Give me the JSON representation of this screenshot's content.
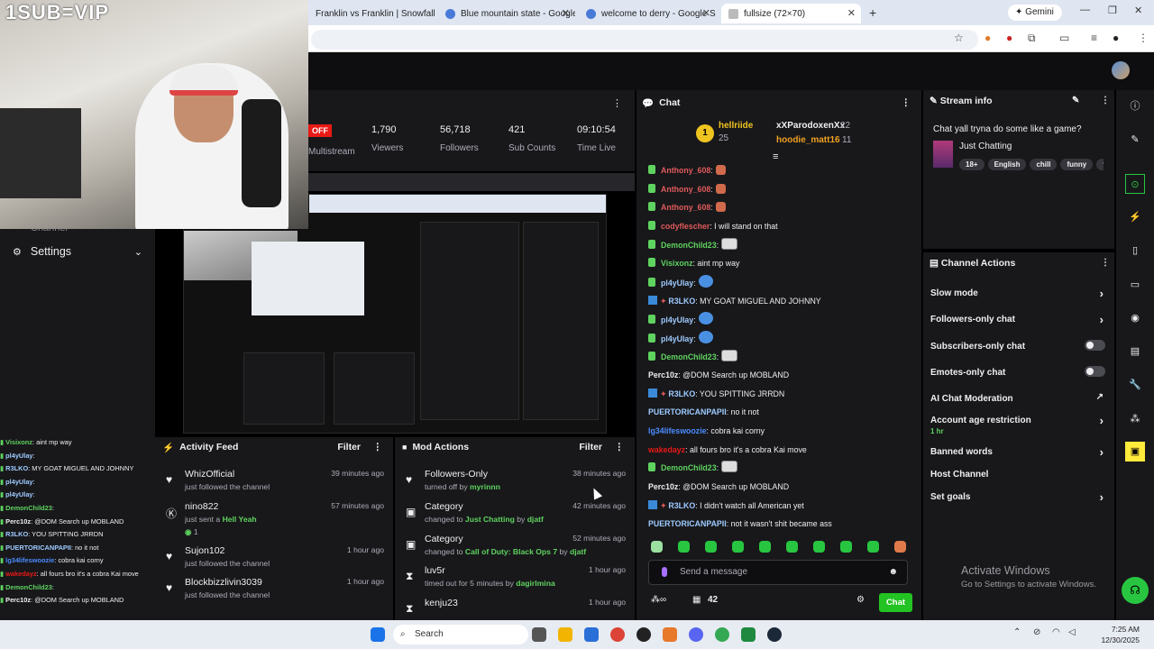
{
  "browser": {
    "tabs": [
      {
        "title": "Franklin vs Franklin | Snowfall |"
      },
      {
        "title": "Blue mountain state - Google S"
      },
      {
        "title": "welcome to derry - Google Sea"
      },
      {
        "title": "fullsize (72×70)"
      }
    ],
    "gemini_label": "Gemini"
  },
  "overlay": {
    "vip_text": "1SUB=VIP"
  },
  "sidebar": {
    "channel_label": "Channel",
    "settings_label": "Settings"
  },
  "stats": {
    "off_badge": "OFF",
    "multistream_label": "Multistream",
    "items": [
      {
        "value": "1,790",
        "label": "Viewers"
      },
      {
        "value": "56,718",
        "label": "Followers"
      },
      {
        "value": "421",
        "label": "Sub Counts"
      },
      {
        "value": "09:10:54",
        "label": "Time Live"
      }
    ]
  },
  "mini_chat": [
    {
      "name": "Visixonz",
      "text": ": aint mp way",
      "color": "#5fd35f"
    },
    {
      "name": "pl4yUlay",
      "text": ":",
      "color": "#9ecbff"
    },
    {
      "name": "R3LKO",
      "text": ": MY GOAT MIGUEL AND JOHNNY",
      "color": "#9ecbff"
    },
    {
      "name": "pl4yUlay",
      "text": ":",
      "color": "#9ecbff"
    },
    {
      "name": "pl4yUlay",
      "text": ":",
      "color": "#9ecbff"
    },
    {
      "name": "DemonChild23",
      "text": ":",
      "color": "#5fd35f"
    },
    {
      "name": "Perc10z",
      "text": ": @DOM Search up MOBLAND",
      "color": "#efeff1"
    },
    {
      "name": "R3LKO",
      "text": ": YOU SPITTING JRRDN",
      "color": "#9ecbff"
    },
    {
      "name": "PUERTORICANPAPII",
      "text": ": no it not",
      "color": "#9ecbff"
    },
    {
      "name": "lg34lifeswoozie",
      "text": ": cobra kai corny",
      "color": "#4a8cff"
    },
    {
      "name": "wakedayz",
      "text": ": all fours bro it's a cobra Kai move",
      "color": "#e91916"
    },
    {
      "name": "DemonChild23",
      "text": ":",
      "color": "#5fd35f"
    },
    {
      "name": "Perc10z",
      "text": ": @DOM Search up MOBLAND",
      "color": "#efeff1"
    }
  ],
  "activity_feed": {
    "title": "Activity Feed",
    "filter_label": "Filter",
    "events": [
      {
        "name": "WhizOfficial",
        "desc": "just followed the channel",
        "time": "39 minutes ago",
        "icon": "heart-icon"
      },
      {
        "name": "nino822",
        "desc": "just sent a ",
        "highlight": "Hell Yeah",
        "extra": "1",
        "time": "57 minutes ago",
        "icon": "kick-icon"
      },
      {
        "name": "Sujon102",
        "desc": "just followed the channel",
        "time": "1 hour ago",
        "icon": "heart-icon"
      },
      {
        "name": "Blockbizzlivin3039",
        "desc": "just followed the channel",
        "time": "1 hour ago",
        "icon": "heart-icon"
      }
    ]
  },
  "mod_actions": {
    "title": "Mod Actions",
    "filter_label": "Filter",
    "events": [
      {
        "name": "Followers-Only",
        "desc": "turned off by ",
        "by": "myrinnn",
        "time": "38 minutes ago",
        "icon": "heart-icon"
      },
      {
        "name": "Category",
        "desc": "changed to ",
        "target": "Just Chatting",
        "by_prefix": " by ",
        "by": "djatf",
        "time": "42 minutes ago",
        "icon": "category-icon"
      },
      {
        "name": "Category",
        "desc": "changed to ",
        "target": "Call of Duty: Black Ops 7",
        "by_prefix": " by ",
        "by": "djatf",
        "time": "52 minutes ago",
        "icon": "category-icon"
      },
      {
        "name": "luv5r",
        "desc": "timed out for 5 minutes by ",
        "by": "dagirlmina",
        "time": "1 hour ago",
        "icon": "hourglass-icon"
      },
      {
        "name": "kenju23",
        "desc": "",
        "by": "",
        "time": "1 hour ago",
        "icon": "hourglass-icon"
      }
    ]
  },
  "chat": {
    "title": "Chat",
    "leaderboard": {
      "rank1_name": "hellriide",
      "rank1_count": "25",
      "rank2_name": "xXParodoxenXx",
      "rank2_count": "22",
      "rank3_name": "hoodie_matt16",
      "rank3_count": "11"
    },
    "messages": [
      {
        "name": "Anthony_608",
        "text": ":",
        "color": "#e05a5a",
        "badge": "green",
        "emote": "red"
      },
      {
        "name": "Anthony_608",
        "text": ":",
        "color": "#e05a5a",
        "badge": "green",
        "emote": "red"
      },
      {
        "name": "Anthony_608",
        "text": ":",
        "color": "#e05a5a",
        "badge": "green",
        "emote": "red"
      },
      {
        "name": "codyflescher",
        "text": ": I will stand on that",
        "color": "#e05a5a",
        "badge": "green",
        "emote": ""
      },
      {
        "name": "DemonChild23",
        "text": ":",
        "color": "#5fd35f",
        "badge": "green",
        "emote": "bw"
      },
      {
        "name": "Visixonz",
        "text": ": aint mp way",
        "color": "#5fd35f",
        "badge": "green",
        "emote": ""
      },
      {
        "name": "pl4yUlay",
        "text": ":",
        "color": "#9ecbff",
        "badge": "green",
        "emote": "blue"
      },
      {
        "name": "R3LKO",
        "text": ": MY GOAT MIGUEL AND JOHNNY",
        "color": "#9ecbff",
        "badge": "blue",
        "emote": ""
      },
      {
        "name": "pl4yUlay",
        "text": ":",
        "color": "#9ecbff",
        "badge": "green",
        "emote": "blue"
      },
      {
        "name": "pl4yUlay",
        "text": ":",
        "color": "#9ecbff",
        "badge": "green",
        "emote": "blue"
      },
      {
        "name": "DemonChild23",
        "text": ":",
        "color": "#5fd35f",
        "badge": "green",
        "emote": "bw"
      },
      {
        "name": "Perc10z",
        "text": ": @DOM Search up MOBLAND",
        "color": "#efeff1",
        "badge": "",
        "emote": ""
      },
      {
        "name": "R3LKO",
        "text": ": YOU SPITTING JRRDN",
        "color": "#9ecbff",
        "badge": "blue",
        "emote": ""
      },
      {
        "name": "PUERTORICANPAPII",
        "text": ": no it not",
        "color": "#9ecbff",
        "badge": "",
        "emote": ""
      },
      {
        "name": "lg34lifeswoozie",
        "text": ": cobra kai corny",
        "color": "#4a8cff",
        "badge": "",
        "emote": ""
      },
      {
        "name": "wakedayz",
        "text": ": all fours bro it's a cobra Kai move",
        "color": "#e91916",
        "badge": "",
        "emote": ""
      },
      {
        "name": "DemonChild23",
        "text": ":",
        "color": "#5fd35f",
        "badge": "green",
        "emote": "bw"
      },
      {
        "name": "Perc10z",
        "text": ": @DOM Search up MOBLAND",
        "color": "#efeff1",
        "badge": "",
        "emote": ""
      },
      {
        "name": "R3LKO",
        "text": ": I didn't watch all American yet",
        "color": "#9ecbff",
        "badge": "blue",
        "emote": ""
      },
      {
        "name": "PUERTORICANPAPII",
        "text": ": not it wasn't shit became ass",
        "color": "#9ecbff",
        "badge": "",
        "emote": ""
      }
    ],
    "input_placeholder": "Send a message",
    "viewer_count": "42",
    "chat_button": "Chat"
  },
  "stream_info": {
    "title": "Stream info",
    "stream_title": "Chat yall tryna do some like a game?",
    "category": "Just Chatting",
    "tags": [
      "18+",
      "English",
      "chill",
      "funny",
      "funn"
    ]
  },
  "channel_actions": {
    "title": "Channel Actions",
    "items": [
      {
        "label": "Slow mode",
        "control": "chevron"
      },
      {
        "label": "Followers-only chat",
        "control": "chevron"
      },
      {
        "label": "Subscribers-only chat",
        "control": "toggle"
      },
      {
        "label": "Emotes-only chat",
        "control": "toggle"
      },
      {
        "label": "AI Chat Moderation",
        "control": "external"
      },
      {
        "label": "Account age restriction",
        "sub": "1 hr",
        "control": "chevron"
      },
      {
        "label": "Banned words",
        "control": "chevron"
      },
      {
        "label": "Host Channel",
        "control": ""
      },
      {
        "label": "Set goals",
        "control": "chevron"
      }
    ]
  },
  "windows": {
    "activate_title": "Activate Windows",
    "activate_sub": "Go to Settings to activate Windows.",
    "search_label": "Search",
    "time": "7:25 AM",
    "date": "12/30/2025"
  },
  "colors": {
    "accent_green": "#53fc18",
    "panel_bg": "#18181b",
    "page_bg": "#0e0e10"
  }
}
